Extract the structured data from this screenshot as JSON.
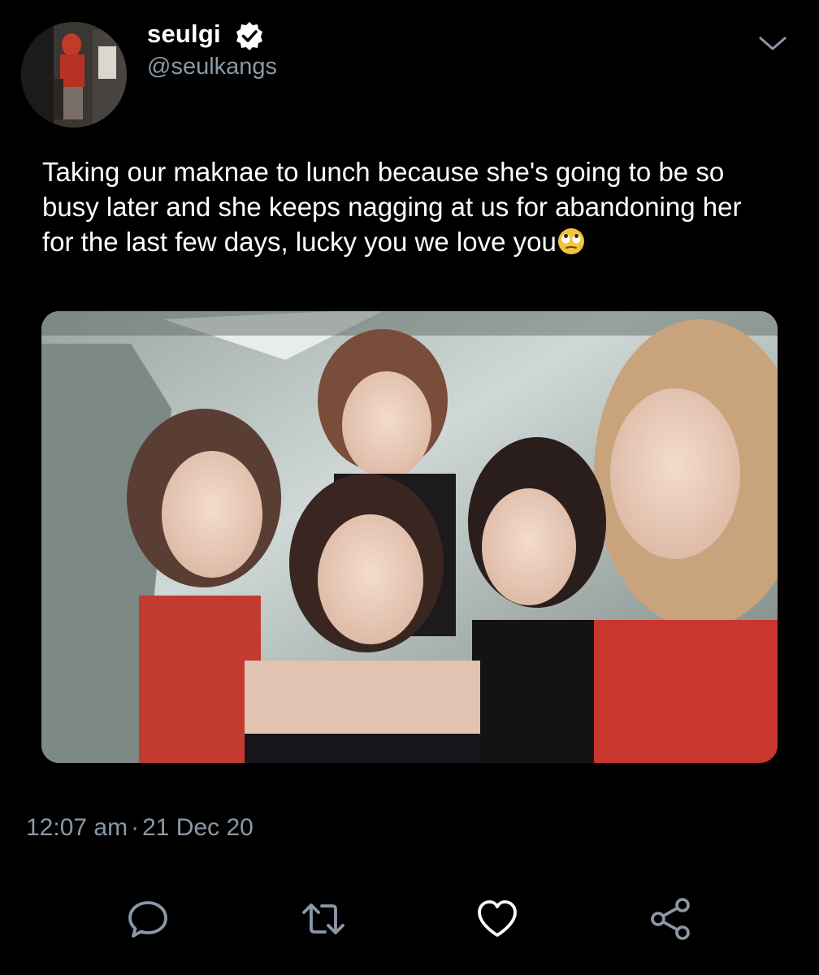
{
  "user": {
    "display_name": "seulgi",
    "handle": "@seulkangs",
    "verified": true
  },
  "tweet": {
    "text": "Taking our maknae to lunch because she's going to be so busy later and she keeps nagging at us for abandoning her for the last few days, lucky you we love you",
    "emoji": "face-with-rolling-eyes"
  },
  "timestamp": {
    "time": "12:07 am",
    "separator": "·",
    "date": "21 Dec 20"
  },
  "actions": [
    "reply-icon",
    "retweet-icon",
    "like-icon",
    "share-icon"
  ],
  "colors": {
    "background": "#000000",
    "text": "#ffffff",
    "secondary_text": "#8b98a5",
    "icon": "#8b98a5",
    "verified_badge": "#ffffff"
  }
}
